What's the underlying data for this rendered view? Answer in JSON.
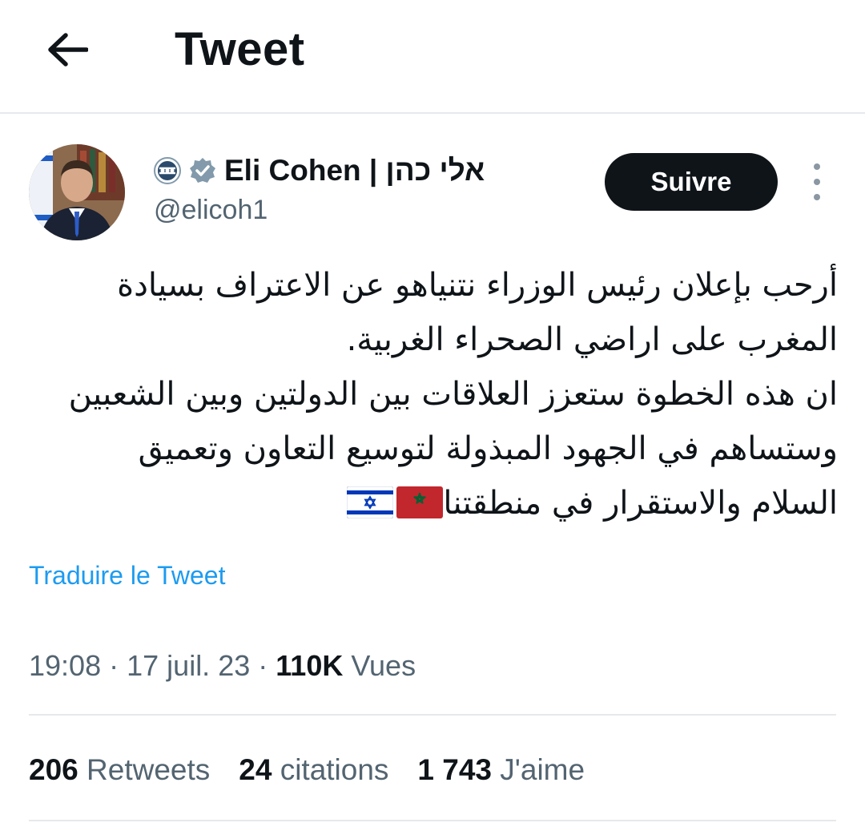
{
  "header": {
    "title": "Tweet",
    "back_icon": "arrow-left-icon"
  },
  "author": {
    "display_name": "Eli Cohen | אלי כהן",
    "handle": "@elicoh1",
    "affiliation_icon": "government-badge-icon",
    "verified_icon": "verified-badge-icon",
    "verified_color": "#829aab"
  },
  "actions": {
    "follow_label": "Suivre",
    "more_icon": "more-vertical-icon"
  },
  "tweet": {
    "lines": [
      "أرحب بإعلان رئيس الوزراء نتنياهو عن الاعتراف بسيادة",
      "المغرب على اراضي الصحراء الغربية.",
      "ان هذه الخطوة ستعزز العلاقات بين الدولتين وبين الشعبين",
      "وستساهم في الجهود المبذولة لتوسيع التعاون وتعميق",
      "السلام والاستقرار في منطقتنا"
    ],
    "flags": [
      "morocco-flag",
      "israel-flag"
    ],
    "translate_label": "Traduire le Tweet"
  },
  "meta": {
    "time": "19:08",
    "separator": "·",
    "date": "17 juil. 23",
    "views_count": "110K",
    "views_label": "Vues"
  },
  "stats": {
    "retweets_count": "206",
    "retweets_label": "Retweets",
    "quotes_count": "24",
    "quotes_label": "citations",
    "likes_count": "1 743",
    "likes_label": "J'aime"
  },
  "colors": {
    "text": "#0f1419",
    "secondary": "#536471",
    "link": "#1d9bf0",
    "follow_bg": "#0f1419",
    "divider": "#e6e9ec"
  }
}
